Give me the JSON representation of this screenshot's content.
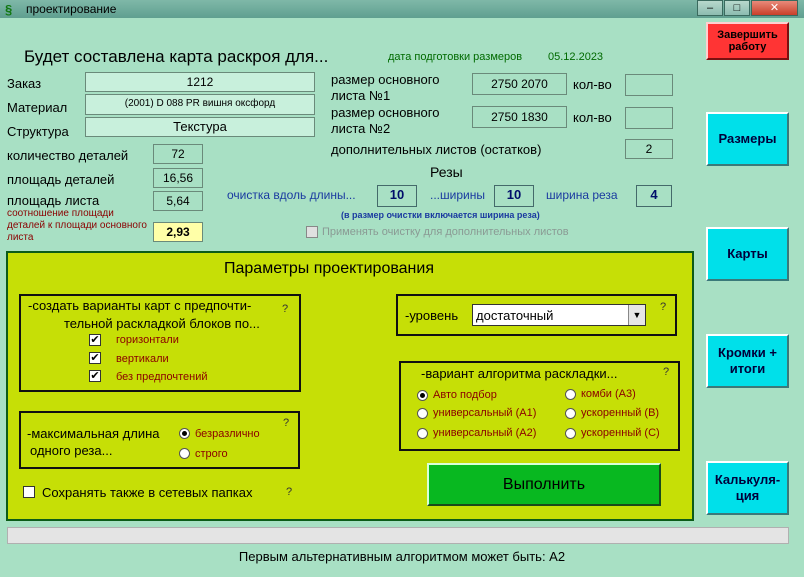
{
  "window": {
    "title": "проектирование",
    "min": "–",
    "max": "□",
    "close": "✕"
  },
  "header": {
    "heading": "Будет составлена карта раскроя для...",
    "date_label": "дата подготовки размеров",
    "date_value": "05.12.2023"
  },
  "left": {
    "order_label": "Заказ",
    "order_value": "1212",
    "material_label": "Материал",
    "material_value": "(2001) D 088 PR вишня оксфорд",
    "structure_label": "Структура",
    "structure_value": "Текстура",
    "parts_count_label": "количество деталей",
    "parts_count_value": "72",
    "parts_area_label": "площадь деталей",
    "parts_area_value": "16,56",
    "sheet_area_label": "площадь листа",
    "sheet_area_value": "5,64",
    "ratio_label": "соотношение площади деталей к площади основного листа",
    "ratio_value": "2,93"
  },
  "sheets": {
    "sheet1_label": "размер основного листа №1",
    "sheet1_value": "2750 2070",
    "qty1_label": "кол-во",
    "qty1_value": "",
    "sheet2_label": "размер основного листа №2",
    "sheet2_value": "2750 1830",
    "qty2_label": "кол-во",
    "qty2_value": "",
    "extra_label": "дополнительных листов (остатков)",
    "extra_value": "2"
  },
  "cuts": {
    "title": "Резы",
    "length_label": "очистка вдоль длины...",
    "length_value": "10",
    "width_label": "...ширины",
    "width_value": "10",
    "kerf_label": "ширина реза",
    "kerf_value": "4",
    "note": "(в размер очистки включается ширина реза)",
    "apply_label": "Применять очистку для дополнительных листов"
  },
  "params": {
    "title": "Параметры проектирования",
    "pref_title_1": "-создать варианты карт с предпочти-",
    "pref_title_2": "тельной раскладкой блоков по...",
    "pref_options": [
      "горизонтали",
      "вертикали",
      "без предпочтений"
    ],
    "maxlen_title_1": "-максимальная длина",
    "maxlen_title_2": "одного реза...",
    "maxlen_options": [
      "безразлично",
      "строго"
    ],
    "save_net_label": "Сохранять также в сетевых папках",
    "level_label": "-уровень",
    "level_value": "достаточный",
    "algo_title": "-вариант алгоритма раскладки...",
    "algo_options": [
      "Авто подбор",
      "универсальный (A1)",
      "универсальный (A2)",
      "комби (A3)",
      "ускоренный (B)",
      "ускоренный (C)"
    ],
    "run_label": "Выполнить",
    "q": "?"
  },
  "nav": {
    "finish": "Завершить работу",
    "sizes": "Размеры",
    "cards": "Карты",
    "edges": "Кромки + итоги",
    "calc": "Калькуля-ция"
  },
  "status": {
    "text": "Первым альтернативным алгоритмом может быть: A2"
  },
  "colors": {
    "accent": "#00e0ea",
    "panel": "#c6df06",
    "run": "#08b820",
    "background": "#a8e0c4"
  }
}
